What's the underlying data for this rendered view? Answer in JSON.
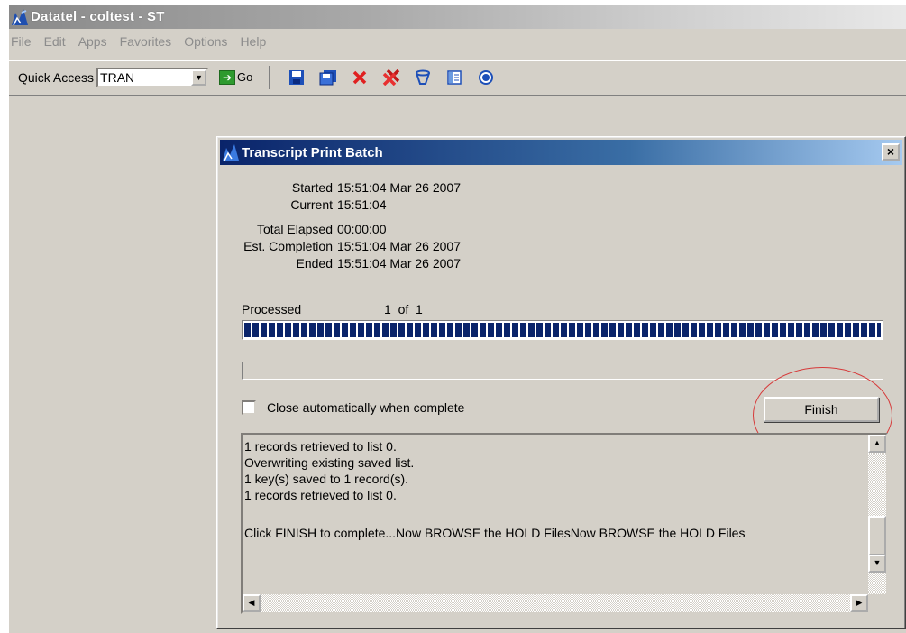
{
  "window": {
    "title": "Datatel - coltest - ST",
    "icon": "datatel-logo-icon"
  },
  "menu": [
    "File",
    "Edit",
    "Apps",
    "Favorites",
    "Options",
    "Help"
  ],
  "toolbar": {
    "quick_access_label": "Quick Access",
    "quick_access_value": "TRAN",
    "go_label": "Go",
    "icons": [
      "save-icon",
      "save-all-icon",
      "cancel-icon",
      "cancel-all-icon",
      "filter-icon",
      "list-icon",
      "help-icon"
    ]
  },
  "dialog": {
    "title": "Transcript Print Batch",
    "close_glyph": "×",
    "rows": [
      {
        "label": "Started",
        "value": "15:51:04 Mar 26 2007"
      },
      {
        "label": "Current",
        "value": "15:51:04"
      },
      {
        "label": "Total Elapsed",
        "value": "00:00:00"
      },
      {
        "label": "Est. Completion",
        "value": "15:51:04 Mar 26 2007"
      },
      {
        "label": "Ended",
        "value": "15:51:04 Mar 26 2007"
      }
    ],
    "processed_label": "Processed",
    "processed_count": "1  of  1",
    "progress_fraction": 1.0,
    "checkbox_label": "Close automatically when complete",
    "checkbox_checked": false,
    "finish_label": "Finish",
    "log_lines": [
      "1 records retrieved to list 0.",
      "Overwriting existing saved list.",
      "1 key(s) saved to 1 record(s).",
      "1 records retrieved to list 0.",
      "",
      "Click FINISH to complete...Now BROWSE the HOLD FilesNow BROWSE the HOLD Files"
    ]
  },
  "colors": {
    "window_title_gradient_start": "#8a8a8a",
    "dialog_title_start": "#0a246a",
    "dialog_title_end": "#a6caf0",
    "progress": "#0a246a",
    "highlight_circle": "#d63a3a",
    "face": "#d4d0c8"
  }
}
